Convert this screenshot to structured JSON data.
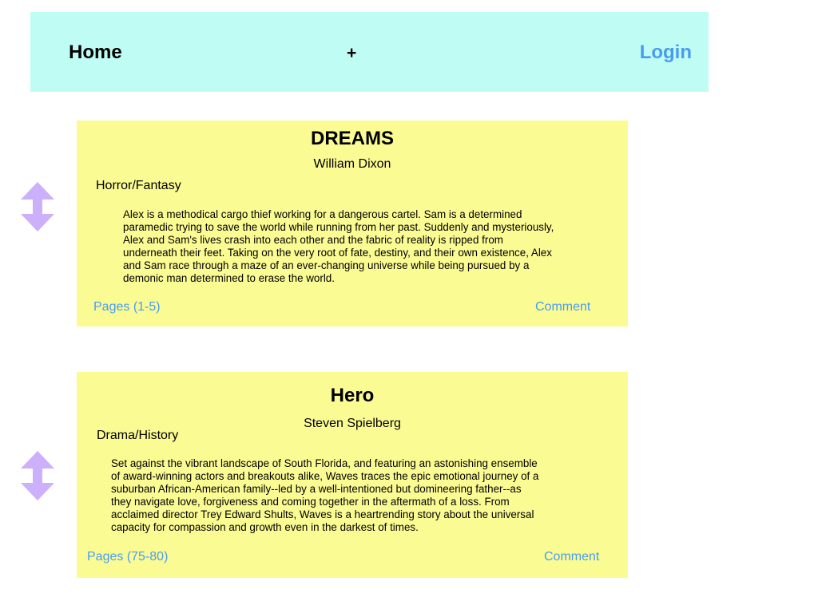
{
  "theme": {
    "navbar_bg": "#bffcf4",
    "card_bg": "#fbfb94",
    "link_color": "#4a9cf0",
    "handle_color": "#cdb0fb"
  },
  "nav": {
    "home_label": "Home",
    "add_label": "+",
    "login_label": "Login"
  },
  "cards": [
    {
      "title": "DREAMS",
      "author": "William Dixon",
      "genre": "Horror/Fantasy",
      "description": [
        "Alex is a methodical cargo thief working for a dangerous cartel. Sam is a determined",
        "paramedic trying to save the world while running from her past. Suddenly and mysteriously,",
        "Alex and Sam's lives crash into each other and the fabric of reality is ripped from",
        "underneath their feet. Taking on the very root of fate, destiny, and their own existence, Alex",
        "and Sam race through a maze of an ever-changing universe while being pursued by a",
        "demonic man determined to erase the world."
      ],
      "pages_label": "Pages (1-5)",
      "comment_label": "Comment",
      "handle_icon": "sort-arrows-icon"
    },
    {
      "title": "Hero",
      "author": "Steven Spielberg",
      "genre": "Drama/History",
      "description": [
        "Set against the vibrant landscape of South Florida, and featuring an astonishing ensemble",
        "of award-winning actors and breakouts alike, Waves traces the epic emotional journey of a",
        "suburban African-American family--led by a well-intentioned but domineering father--as",
        "they navigate love, forgiveness and coming together in the aftermath of a loss. From",
        "acclaimed director Trey Edward Shults, Waves is a heartrending story about the universal",
        "capacity for compassion and growth even in the darkest of times."
      ],
      "pages_label": "Pages (75-80)",
      "comment_label": "Comment",
      "handle_icon": "sort-arrows-icon"
    }
  ]
}
